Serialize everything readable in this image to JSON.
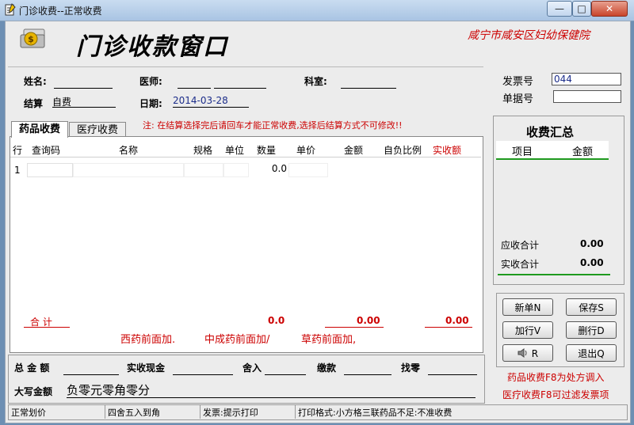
{
  "window": {
    "title": "门诊收费--正常收费",
    "min_label": "—",
    "max_label": "□",
    "close_label": "✕"
  },
  "header": {
    "app_title": "门诊收款窗口",
    "hospital": "咸宁市咸安区妇幼保健院"
  },
  "form": {
    "name_label": "姓名:",
    "doctor_label": "医师:",
    "dept_label": "科室:",
    "invoice_label": "发票号",
    "invoice_value": "044",
    "receipt_label": "单据号",
    "settle_label": "结算",
    "settle_value": "自费",
    "date_label": "日期:",
    "date_value": "2014-03-28"
  },
  "notice": "注: 在结算选择完后请回车才能正常收费,选择后结算方式不可修改!!",
  "tabs": [
    {
      "label": "药品收费",
      "active": true
    },
    {
      "label": "医疗收费",
      "active": false
    }
  ],
  "table": {
    "headers": [
      "行",
      "查询码",
      "名称",
      "规格",
      "单位",
      "数量",
      "单价",
      "金额",
      "自负比例",
      "实收额"
    ],
    "rows": [
      {
        "line": "1",
        "qty": "0.0"
      }
    ],
    "total_label": "合 计",
    "total_qty": "0.0",
    "total_amount": "0.00",
    "total_actual": "0.00",
    "hints": [
      "西药前面加.",
      "中成药前面加/",
      "草药前面加,"
    ]
  },
  "summary": {
    "title": "收费汇总",
    "col_item": "项目",
    "col_amount": "金额",
    "receivable_label": "应收合计",
    "receivable_value": "0.00",
    "received_label": "实收合计",
    "received_value": "0.00"
  },
  "buttons": {
    "new": "新单N",
    "save": "保存S",
    "add_line": "加行V",
    "delete_line": "删行D",
    "speaker": "R",
    "exit": "退出Q"
  },
  "hints_right": [
    "药品收费F8为处方调入",
    "医疗收费F8可过滤发票项"
  ],
  "bottom": {
    "total_label": "总 金 额",
    "cash_label": "实收现金",
    "round_label": "舍入",
    "paid_label": "缴款",
    "change_label": "找零",
    "caps_label": "大写金额",
    "caps_value": "负零元零角零分"
  },
  "status": {
    "pricing": "正常划价",
    "rounding": "四舍五入到角",
    "invoice": "发票:提示打印",
    "print_format": "打印格式:小方格三联药品不足:不准收费"
  },
  "colors": {
    "accent_red": "#cc0000",
    "summary_green": "#1f9a1f",
    "title_bar": "#b8cfe9"
  }
}
